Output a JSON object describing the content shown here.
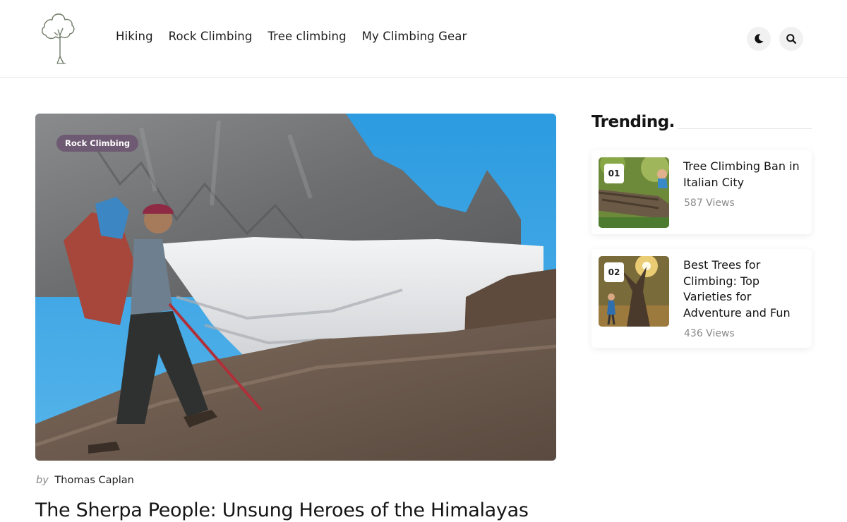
{
  "nav": {
    "items": [
      "Hiking",
      "Rock Climbing",
      "Tree climbing",
      "My Climbing Gear"
    ]
  },
  "header": {
    "dark_mode_icon": "moon-icon",
    "search_icon": "search-icon",
    "logo_icon": "tree-logo-icon"
  },
  "featured": {
    "category": "Rock Climbing",
    "by_label": "by",
    "author": "Thomas Caplan",
    "title": "The Sherpa People: Unsung Heroes of the Himalayas"
  },
  "sidebar": {
    "heading": "Trending.",
    "items": [
      {
        "rank": "01",
        "title": "Tree Climbing Ban in Italian City",
        "views": "587 Views"
      },
      {
        "rank": "02",
        "title": "Best Trees for Climbing: Top Varieties for Adventure and Fun",
        "views": "436 Views"
      }
    ]
  },
  "colors": {
    "badge": "#6e5a72",
    "text": "#151515",
    "muted": "#8a8a8a"
  }
}
